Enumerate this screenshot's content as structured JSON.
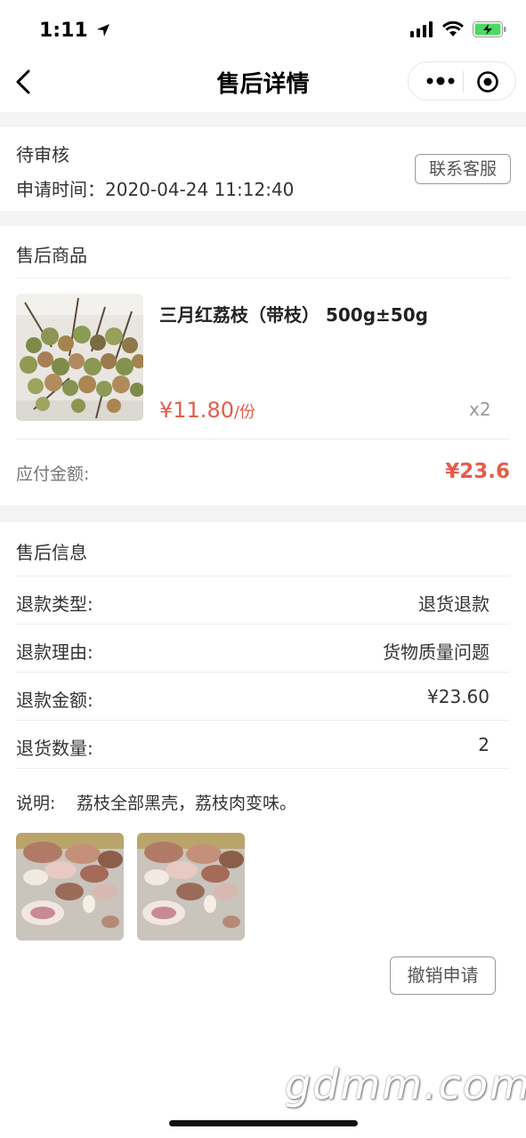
{
  "status_bar": {
    "time": "1:11"
  },
  "nav": {
    "title": "售后详情"
  },
  "status_section": {
    "status": "待审核",
    "apply_time": "申请时间：2020-04-24 11:12:40",
    "contact_button": "联系客服"
  },
  "goods_section": {
    "title": "售后商品",
    "product": {
      "name": "三月红荔枝（带枝） 500g±50g",
      "price": "¥11.80",
      "unit": "/份",
      "quantity": "x2"
    },
    "payable_label": "应付金额:",
    "payable_value": "¥23.6"
  },
  "info_section": {
    "title": "售后信息",
    "rows": [
      {
        "label": "退款类型:",
        "value": "退货退款"
      },
      {
        "label": "退款理由:",
        "value": "货物质量问题"
      },
      {
        "label": "退款金额:",
        "value": "¥23.60"
      },
      {
        "label": "退货数量:",
        "value": "2"
      }
    ],
    "note_label": "说明:",
    "note_text": "荔枝全部黑壳，荔枝肉变味。",
    "cancel_button": "撤销申请"
  },
  "watermark": "gdmm.com",
  "colors": {
    "accent_red": "#e25d4a",
    "background_gray": "#f4f4f4"
  }
}
